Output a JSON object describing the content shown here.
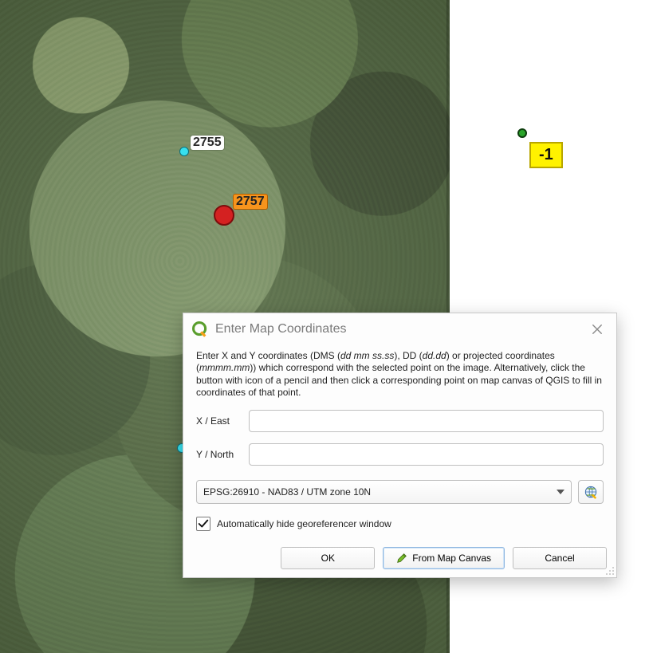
{
  "aerial": {
    "points": {
      "cyan1_label": "2755",
      "red_label": "2757"
    }
  },
  "map_right": {
    "marker_label": "-1"
  },
  "dialog": {
    "title": "Enter Map Coordinates",
    "desc_pre": "Enter X and Y coordinates (DMS (",
    "desc_dms": "dd mm ss.ss",
    "desc_mid1": "), DD (",
    "desc_dd": "dd.dd",
    "desc_mid2": ") or projected coordinates (",
    "desc_proj": "mmmm.mm",
    "desc_post": ")) which correspond with the selected point on the image. Alternatively, click the button with icon of a pencil and then click a corresponding point on map canvas of QGIS to fill in coordinates of that point.",
    "x_label": "X / East",
    "y_label": "Y / North",
    "x_value": "",
    "y_value": "",
    "crs_value": "EPSG:26910 - NAD83 / UTM zone 10N",
    "auto_hide": "Automatically hide georeferencer window",
    "ok": "OK",
    "from_canvas": "From Map Canvas",
    "cancel": "Cancel"
  }
}
